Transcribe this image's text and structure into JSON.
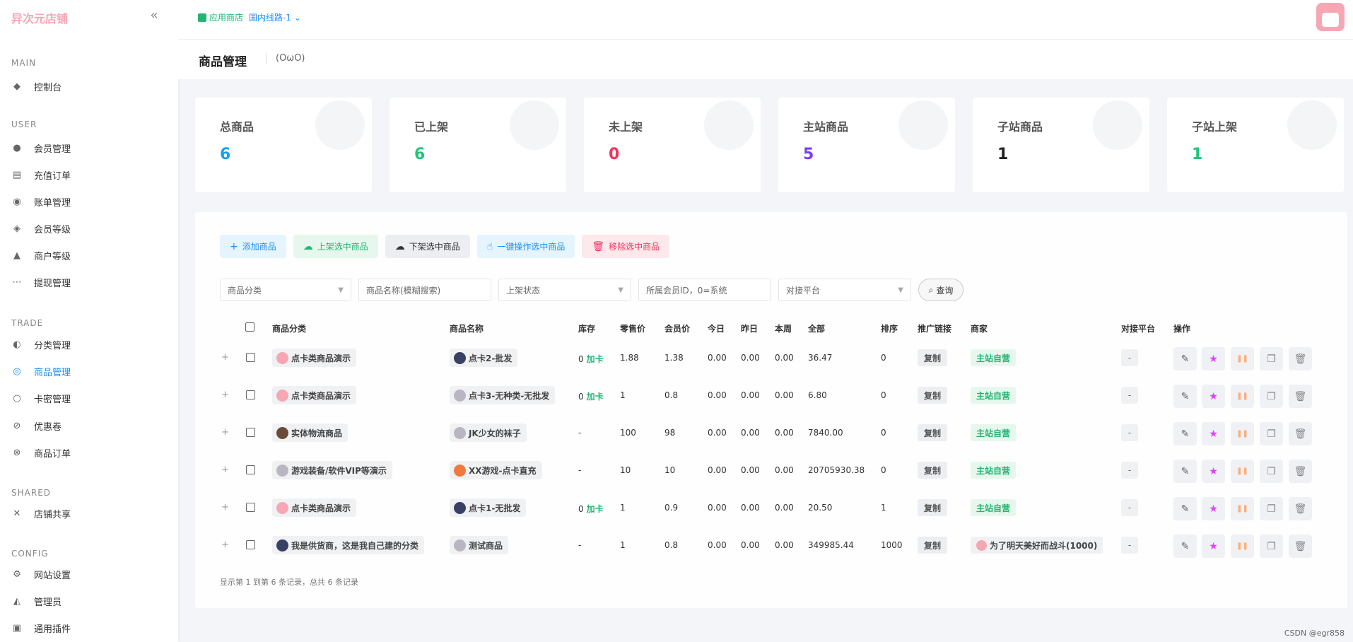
{
  "brand": "异次元店铺",
  "topbar": {
    "store_label": "应用商店",
    "route_label": "国内线路-1"
  },
  "page": {
    "title": "商品管理",
    "subtitle": "(OωO)"
  },
  "sidebar": {
    "sections": [
      {
        "title": "MAIN",
        "items": [
          {
            "label": "控制台",
            "icon": "dashboard-icon"
          }
        ]
      },
      {
        "title": "USER",
        "items": [
          {
            "label": "会员管理",
            "icon": "user-icon"
          },
          {
            "label": "充值订单",
            "icon": "recharge-icon"
          },
          {
            "label": "账单管理",
            "icon": "bill-icon"
          },
          {
            "label": "会员等级",
            "icon": "level-icon"
          },
          {
            "label": "商户等级",
            "icon": "merchant-level-icon"
          },
          {
            "label": "提现管理",
            "icon": "withdraw-icon"
          }
        ]
      },
      {
        "title": "TRADE",
        "items": [
          {
            "label": "分类管理",
            "icon": "category-icon"
          },
          {
            "label": "商品管理",
            "icon": "goods-icon",
            "active": true
          },
          {
            "label": "卡密管理",
            "icon": "card-icon"
          },
          {
            "label": "优惠卷",
            "icon": "coupon-icon"
          },
          {
            "label": "商品订单",
            "icon": "order-icon"
          }
        ]
      },
      {
        "title": "SHARED",
        "items": [
          {
            "label": "店铺共享",
            "icon": "share-icon"
          }
        ]
      },
      {
        "title": "CONFIG",
        "items": [
          {
            "label": "网站设置",
            "icon": "settings-icon"
          },
          {
            "label": "管理员",
            "icon": "admin-icon"
          },
          {
            "label": "通用插件",
            "icon": "plugin-icon"
          }
        ]
      }
    ]
  },
  "stats": [
    {
      "label": "总商品",
      "value": "6",
      "color": "#1aa0e8"
    },
    {
      "label": "已上架",
      "value": "6",
      "color": "#22c57a"
    },
    {
      "label": "未上架",
      "value": "0",
      "color": "#f5335c"
    },
    {
      "label": "主站商品",
      "value": "5",
      "color": "#7b3ff2"
    },
    {
      "label": "子站商品",
      "value": "1",
      "color": "#222222"
    },
    {
      "label": "子站上架",
      "value": "1",
      "color": "#22c57a"
    }
  ],
  "toolbar": {
    "add": "添加商品",
    "up": "上架选中商品",
    "down": "下架选中商品",
    "batch": "一键操作选中商品",
    "remove": "移除选中商品"
  },
  "filters": {
    "category": "商品分类",
    "name_placeholder": "商品名称(模糊搜索)",
    "status": "上架状态",
    "member_placeholder": "所属会员ID，0=系统",
    "platform": "对接平台",
    "query": "查询"
  },
  "table": {
    "headers": [
      "商品分类",
      "商品名称",
      "库存",
      "零售价",
      "会员价",
      "今日",
      "昨日",
      "本周",
      "全部",
      "排序",
      "推广链接",
      "商家",
      "对接平台",
      "操作"
    ],
    "rows": [
      {
        "category": "点卡类商品演示",
        "cat_ava": "pink",
        "name": "点卡2-批发",
        "name_ava": "dark",
        "stock_num": "0",
        "stock_label": "加卡",
        "retail": "1.88",
        "member": "1.38",
        "today": "0.00",
        "yesterday": "0.00",
        "week": "0.00",
        "total": "36.47",
        "sort": "0",
        "link": "复制",
        "merchant": "主站自营",
        "merchant_type": "main",
        "platform": "-"
      },
      {
        "category": "点卡类商品演示",
        "cat_ava": "pink",
        "name": "点卡3-无种类-无批发",
        "name_ava": "gray",
        "stock_num": "0",
        "stock_label": "加卡",
        "retail": "1",
        "member": "0.8",
        "today": "0.00",
        "yesterday": "0.00",
        "week": "0.00",
        "total": "6.80",
        "sort": "0",
        "link": "复制",
        "merchant": "主站自营",
        "merchant_type": "main",
        "platform": "-"
      },
      {
        "category": "实体物流商品",
        "cat_ava": "brown",
        "name": "JK少女的袜子",
        "name_ava": "gray",
        "stock_num": "-",
        "stock_label": "",
        "retail": "100",
        "member": "98",
        "today": "0.00",
        "yesterday": "0.00",
        "week": "0.00",
        "total": "7840.00",
        "sort": "0",
        "link": "复制",
        "merchant": "主站自营",
        "merchant_type": "main",
        "platform": "-"
      },
      {
        "category": "游戏装备/软件VIP等演示",
        "cat_ava": "gray",
        "name": "XX游戏-点卡直充",
        "name_ava": "orange",
        "stock_num": "-",
        "stock_label": "",
        "retail": "10",
        "member": "10",
        "today": "0.00",
        "yesterday": "0.00",
        "week": "0.00",
        "total": "20705930.38",
        "sort": "0",
        "link": "复制",
        "merchant": "主站自营",
        "merchant_type": "main",
        "platform": "-"
      },
      {
        "category": "点卡类商品演示",
        "cat_ava": "pink",
        "name": "点卡1-无批发",
        "name_ava": "dark",
        "stock_num": "0",
        "stock_label": "加卡",
        "retail": "1",
        "member": "0.9",
        "today": "0.00",
        "yesterday": "0.00",
        "week": "0.00",
        "total": "20.50",
        "sort": "1",
        "link": "复制",
        "merchant": "主站自营",
        "merchant_type": "main",
        "platform": "-"
      },
      {
        "category": "我是供货商，这是我自己建的分类",
        "cat_ava": "dark",
        "name": "测试商品",
        "name_ava": "gray",
        "stock_num": "-",
        "stock_label": "",
        "retail": "1",
        "member": "0.8",
        "today": "0.00",
        "yesterday": "0.00",
        "week": "0.00",
        "total": "349985.44",
        "sort": "1000",
        "link": "复制",
        "merchant": "为了明天美好而战斗(1000)",
        "merchant_type": "user",
        "platform": "-"
      }
    ]
  },
  "footer": "显示第 1 到第 6 条记录，总共 6 条记录",
  "watermark": "CSDN @egr858"
}
